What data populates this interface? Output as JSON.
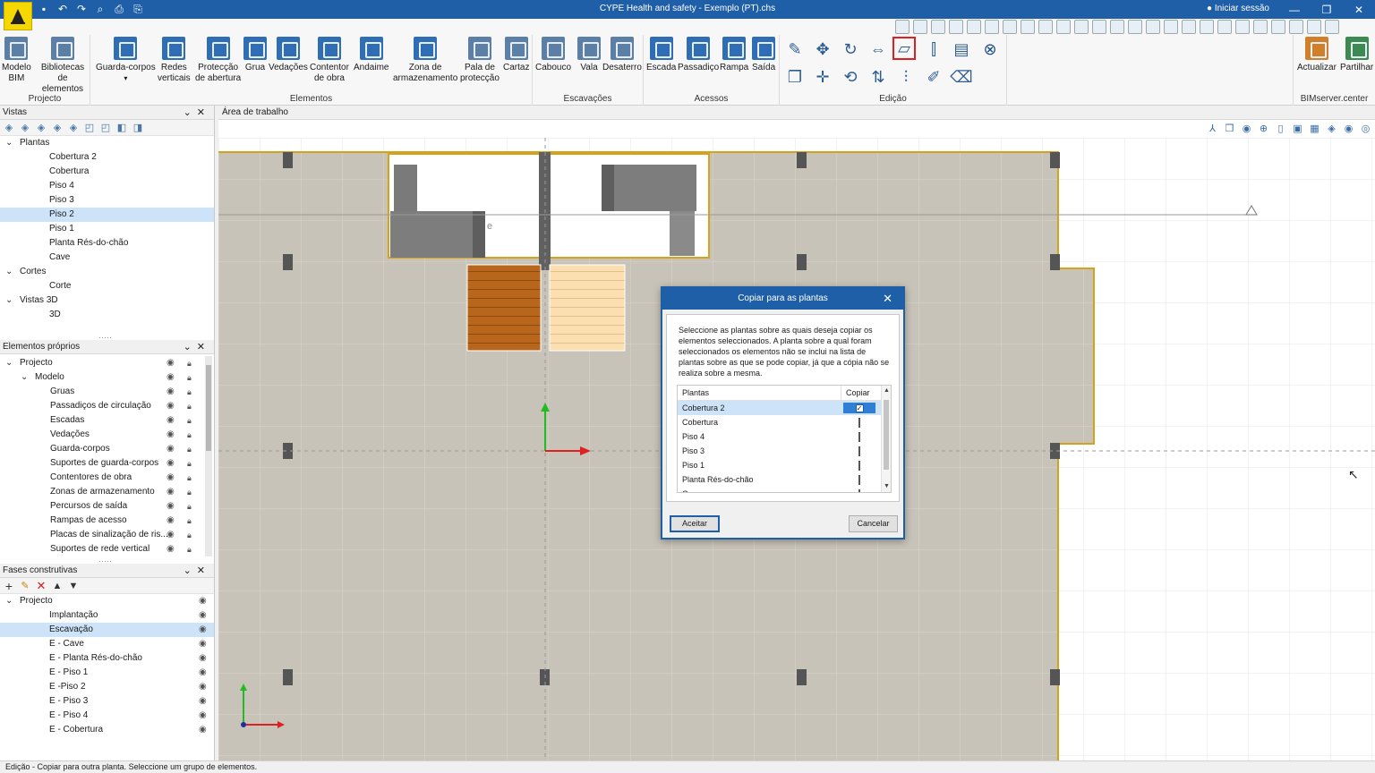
{
  "window": {
    "title": "CYPE Health and safety - Exemplo (PT).chs",
    "login_label": "Iniciar sessão"
  },
  "ribbon": {
    "groups": {
      "projecto": "Projecto",
      "elementos": "Elementos",
      "escavacoes": "Escavações",
      "acessos": "Acessos",
      "edicao": "Edição",
      "bimserver": "BIMserver.center"
    },
    "buttons": {
      "modelo_bim": [
        "Modelo",
        "BIM"
      ],
      "bibliotecas": [
        "Bibliotecas",
        "de elementos"
      ],
      "guarda_corpos": [
        "Guarda-corpos",
        ""
      ],
      "redes_verticais": [
        "Redes",
        "verticais"
      ],
      "proteccao_abertura": [
        "Protecção",
        "de abertura"
      ],
      "grua": [
        "Grua",
        ""
      ],
      "vedacoes": [
        "Vedações",
        ""
      ],
      "contentor": [
        "Contentor",
        "de obra"
      ],
      "andaime": [
        "Andaime",
        ""
      ],
      "zona_armazenamento": [
        "Zona de",
        "armazenamento"
      ],
      "pala": [
        "Pala de",
        "protecção"
      ],
      "cartaz": [
        "Cartaz",
        ""
      ],
      "cabouco": [
        "Cabouco",
        ""
      ],
      "vala": [
        "Vala",
        ""
      ],
      "desaterro": [
        "Desaterro",
        ""
      ],
      "escada": [
        "Escada",
        ""
      ],
      "passadico": [
        "Passadiço",
        ""
      ],
      "rampa": [
        "Rampa",
        ""
      ],
      "saida": [
        "Saída",
        ""
      ],
      "actualizar": [
        "Actualizar",
        ""
      ],
      "partilhar": [
        "Partilhar",
        ""
      ]
    }
  },
  "vistas": {
    "header": "Vistas",
    "items": [
      {
        "label": "Plantas",
        "level": 0,
        "expanded": true
      },
      {
        "label": "Cobertura 2",
        "level": 1
      },
      {
        "label": "Cobertura",
        "level": 1
      },
      {
        "label": "Piso 4",
        "level": 1
      },
      {
        "label": "Piso 3",
        "level": 1
      },
      {
        "label": "Piso 2",
        "level": 1,
        "selected": true
      },
      {
        "label": "Piso 1",
        "level": 1
      },
      {
        "label": "Planta Rés-do-chão",
        "level": 1
      },
      {
        "label": "Cave",
        "level": 1
      },
      {
        "label": "Cortes",
        "level": 0,
        "expanded": true
      },
      {
        "label": "Corte",
        "level": 1
      },
      {
        "label": "Vistas 3D",
        "level": 0,
        "expanded": true
      },
      {
        "label": "3D",
        "level": 1
      }
    ]
  },
  "elementos_proprios": {
    "header": "Elementos próprios",
    "items": [
      {
        "label": "Projecto",
        "level": 0
      },
      {
        "label": "Modelo",
        "level": 1
      },
      {
        "label": "Gruas",
        "level": 2
      },
      {
        "label": "Passadiços de circulação",
        "level": 2
      },
      {
        "label": "Escadas",
        "level": 2
      },
      {
        "label": "Vedações",
        "level": 2
      },
      {
        "label": "Guarda-corpos",
        "level": 2
      },
      {
        "label": "Suportes de guarda-corpos",
        "level": 2
      },
      {
        "label": "Contentores de obra",
        "level": 2
      },
      {
        "label": "Zonas de armazenamento",
        "level": 2
      },
      {
        "label": "Percursos de saída",
        "level": 2
      },
      {
        "label": "Rampas de acesso",
        "level": 2
      },
      {
        "label": "Placas de sinalização de ris...",
        "level": 2
      },
      {
        "label": "Suportes de rede vertical",
        "level": 2
      }
    ]
  },
  "fases": {
    "header": "Fases construtivas",
    "items": [
      {
        "label": "Projecto",
        "level": 0
      },
      {
        "label": "Implantação",
        "level": 1
      },
      {
        "label": "Escavação",
        "level": 1,
        "selected": true
      },
      {
        "label": "E - Cave",
        "level": 1
      },
      {
        "label": "E - Planta Rés-do-chão",
        "level": 1
      },
      {
        "label": "E - Piso 1",
        "level": 1
      },
      {
        "label": "E -Piso 2",
        "level": 1
      },
      {
        "label": "E - Piso 3",
        "level": 1
      },
      {
        "label": "E - Piso 4",
        "level": 1
      },
      {
        "label": "E - Cobertura",
        "level": 1
      }
    ]
  },
  "workarea": {
    "header": "Área de trabalho",
    "floating_label": "e"
  },
  "dialog": {
    "title": "Copiar para as plantas",
    "description": "Seleccione as plantas sobre as quais deseja copiar os elementos seleccionados. A planta sobre a qual foram seleccionados os elementos não se inclui na lista de plantas sobre as que se pode copiar, já que a cópia não se realiza sobre a mesma.",
    "col_plantas": "Plantas",
    "col_copiar": "Copiar",
    "rows": [
      {
        "label": "Cobertura 2",
        "checked": true
      },
      {
        "label": "Cobertura",
        "checked": false
      },
      {
        "label": "Piso 4",
        "checked": false
      },
      {
        "label": "Piso 3",
        "checked": false
      },
      {
        "label": "Piso 1",
        "checked": false
      },
      {
        "label": "Planta Rés-do-chão",
        "checked": false
      },
      {
        "label": "Cave",
        "checked": false
      }
    ],
    "ok_label": "Aceitar",
    "cancel_label": "Cancelar"
  },
  "statusbar": {
    "text": "Edição - Copiar para outra planta. Seleccione um grupo de elementos."
  },
  "colors": {
    "titlebar": "#1f5fa8",
    "slab": "#c7c3b8",
    "wall_outline": "#d4a21c",
    "selection": "#cde3f7"
  }
}
